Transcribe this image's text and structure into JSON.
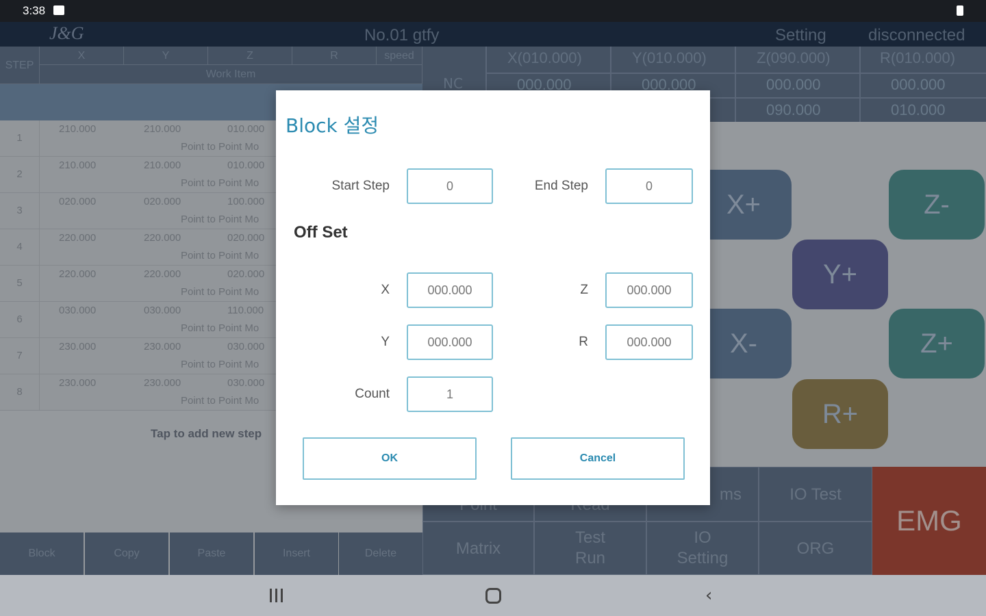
{
  "statusbar": {
    "time": "3:38"
  },
  "header": {
    "logo": "J&G",
    "title": "No.01 gtfy",
    "setting": "Setting",
    "connection": "disconnected"
  },
  "table": {
    "headers": {
      "step": "STEP",
      "x": "X",
      "y": "Y",
      "z": "Z",
      "r": "R",
      "speed": "speed",
      "work_item": "Work Item"
    },
    "rows": [
      {
        "num": "1",
        "x": "210.000",
        "y": "210.000",
        "z": "010.000",
        "mode": "Point to Point Mo"
      },
      {
        "num": "2",
        "x": "210.000",
        "y": "210.000",
        "z": "010.000",
        "mode": "Point to Point Mo"
      },
      {
        "num": "3",
        "x": "020.000",
        "y": "020.000",
        "z": "100.000",
        "mode": "Point to Point Mo"
      },
      {
        "num": "4",
        "x": "220.000",
        "y": "220.000",
        "z": "020.000",
        "mode": "Point to Point Mo"
      },
      {
        "num": "5",
        "x": "220.000",
        "y": "220.000",
        "z": "020.000",
        "mode": "Point to Point Mo"
      },
      {
        "num": "6",
        "x": "030.000",
        "y": "030.000",
        "z": "110.000",
        "mode": "Point to Point Mo"
      },
      {
        "num": "7",
        "x": "230.000",
        "y": "230.000",
        "z": "030.000",
        "mode": "Point to Point Mo"
      },
      {
        "num": "8",
        "x": "230.000",
        "y": "230.000",
        "z": "030.000",
        "mode": "Point to Point Mo"
      }
    ],
    "add_step": "Tap to add new step"
  },
  "bottom_buttons": [
    "Block",
    "Copy",
    "Paste",
    "Insert",
    "Delete"
  ],
  "coords": {
    "nc_label": "NC",
    "headers": [
      "X(010.000)",
      "Y(010.000)",
      "Z(090.000)",
      "R(010.000)"
    ],
    "row1": [
      "000.000",
      "000.000",
      "000.000",
      "000.000"
    ],
    "row2": [
      "090.000",
      "010.000"
    ]
  },
  "jog": {
    "x_plus": "X+",
    "x_minus": "X-",
    "y_plus": "Y+",
    "z_minus": "Z-",
    "z_plus": "Z+",
    "r_plus": "R+"
  },
  "menu": {
    "io_test": "IO Test",
    "matrix": "Matrix",
    "test_run": "Test\nRun",
    "io_setting": "IO\nSetting",
    "org": "ORG",
    "emg": "EMG",
    "partial_point": "Point",
    "partial_read": "Read",
    "partial_params": "ms"
  },
  "dialog": {
    "title": "Block 설정",
    "start_step_label": "Start Step",
    "start_step_value": "0",
    "end_step_label": "End Step",
    "end_step_value": "0",
    "offset_label": "Off Set",
    "x_label": "X",
    "x_value": "000.000",
    "y_label": "Y",
    "y_value": "000.000",
    "z_label": "Z",
    "z_value": "000.000",
    "r_label": "R",
    "r_value": "000.000",
    "count_label": "Count",
    "count_value": "1",
    "ok": "OK",
    "cancel": "Cancel"
  },
  "colors": {
    "accent": "#2a8ab0",
    "input_border": "#7fc0d4",
    "header_bg": "#20324a",
    "emg": "#a4483a"
  }
}
